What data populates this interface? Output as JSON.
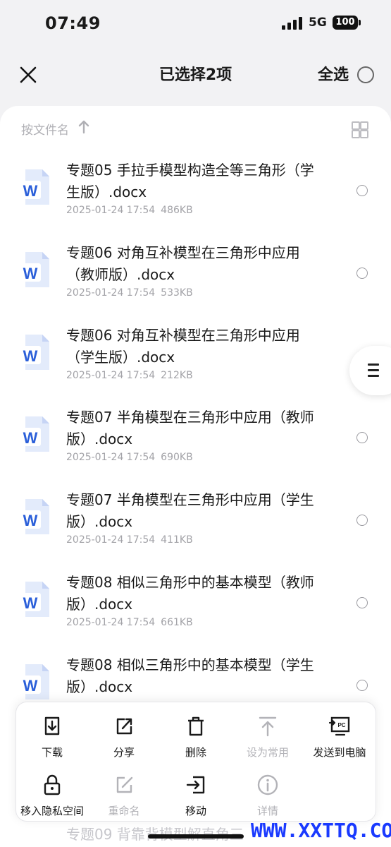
{
  "status": {
    "time": "07:49",
    "network": "5G",
    "battery": "100"
  },
  "header": {
    "title": "已选择2项",
    "select_all": "全选"
  },
  "sort": {
    "label": "按文件名"
  },
  "files": [
    {
      "name": "专题05 手拉手模型构造全等三角形（学生版）.docx",
      "date": "2025-01-24 17:54",
      "size": "486KB"
    },
    {
      "name": "专题06 对角互补模型在三角形中应用（教师版）.docx",
      "date": "2025-01-24 17:54",
      "size": "533KB"
    },
    {
      "name": "专题06 对角互补模型在三角形中应用（学生版）.docx",
      "date": "2025-01-24 17:54",
      "size": "212KB"
    },
    {
      "name": "专题07 半角模型在三角形中应用（教师版）.docx",
      "date": "2025-01-24 17:54",
      "size": "690KB"
    },
    {
      "name": "专题07 半角模型在三角形中应用（学生版）.docx",
      "date": "2025-01-24 17:54",
      "size": "411KB"
    },
    {
      "name": "专题08 相似三角形中的基本模型（教师版）.docx",
      "date": "2025-01-24 17:54",
      "size": "661KB"
    },
    {
      "name": "专题08 相似三角形中的基本模型（学生版）.docx",
      "date": "",
      "size": ""
    }
  ],
  "peek_text": "专题09 背靠背模型解直角三",
  "actions": [
    {
      "label": "下载",
      "icon": "download-icon",
      "enabled": true
    },
    {
      "label": "分享",
      "icon": "share-icon",
      "enabled": true
    },
    {
      "label": "删除",
      "icon": "trash-icon",
      "enabled": true
    },
    {
      "label": "设为常用",
      "icon": "pin-top-icon",
      "enabled": false
    },
    {
      "label": "发送到电脑",
      "icon": "send-to-pc-icon",
      "enabled": true
    },
    {
      "label": "移入隐私空间",
      "icon": "lock-icon",
      "enabled": true
    },
    {
      "label": "重命名",
      "icon": "rename-icon",
      "enabled": false
    },
    {
      "label": "移动",
      "icon": "move-icon",
      "enabled": true
    },
    {
      "label": "详情",
      "icon": "info-icon",
      "enabled": false
    }
  ],
  "watermark": "WWW.XXTTQ.COM",
  "colors": {
    "word_blue": "#2b5fd9",
    "accent_blue": "#1a3aff",
    "muted": "#b3b3b8"
  }
}
